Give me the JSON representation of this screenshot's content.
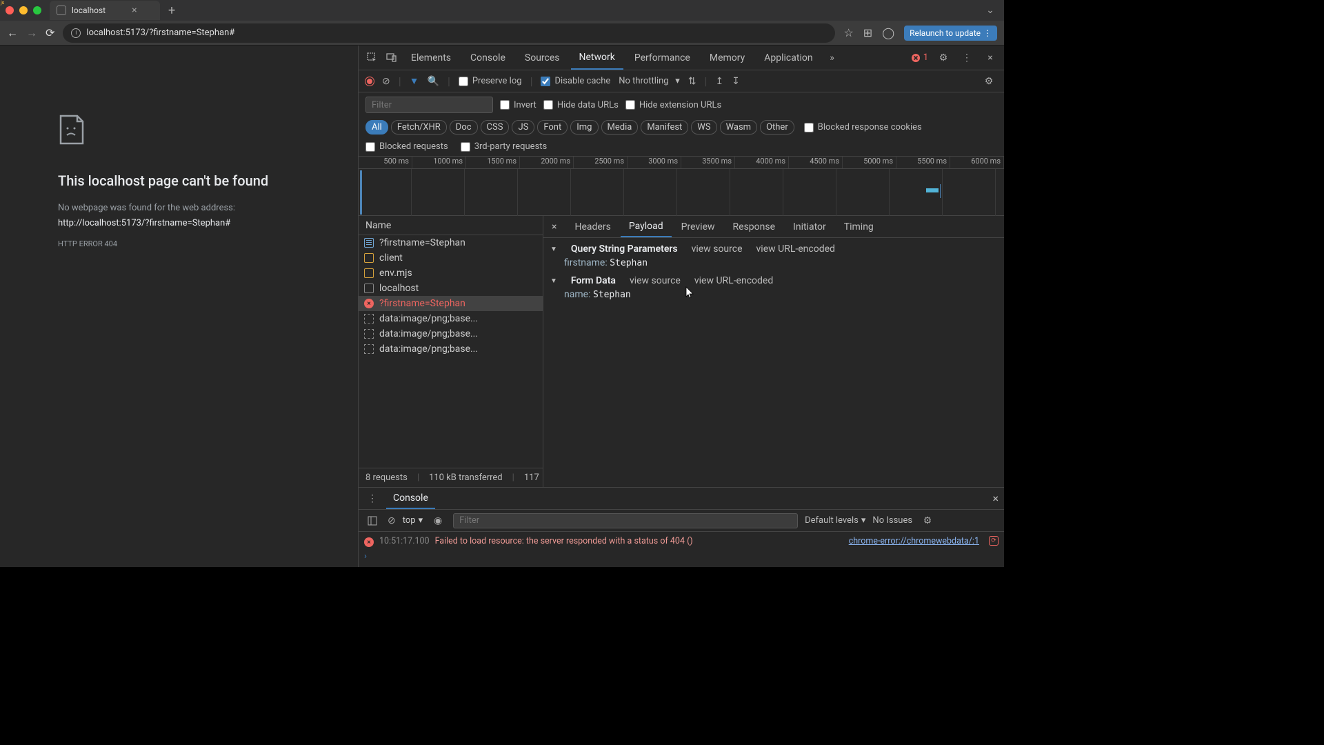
{
  "window": {
    "tab_title": "localhost",
    "url": "localhost:5173/?firstname=Stephan#",
    "relaunch": "Relaunch to update"
  },
  "error_page": {
    "heading": "This localhost page can't be found",
    "subtext": "No webpage was found for the web address:",
    "url": "http://localhost:5173/?firstname=Stephan#",
    "code": "HTTP ERROR 404"
  },
  "devtools": {
    "tabs": {
      "elements": "Elements",
      "console": "Console",
      "sources": "Sources",
      "network": "Network",
      "performance": "Performance",
      "memory": "Memory",
      "application": "Application"
    },
    "errors_count": "1",
    "network": {
      "preserve_log": "Preserve log",
      "disable_cache": "Disable cache",
      "throttling": "No throttling",
      "filter_placeholder": "Filter",
      "invert": "Invert",
      "hide_data": "Hide data URLs",
      "hide_ext": "Hide extension URLs",
      "types": {
        "all": "All",
        "fetch": "Fetch/XHR",
        "doc": "Doc",
        "css": "CSS",
        "js": "JS",
        "font": "Font",
        "img": "Img",
        "media": "Media",
        "manifest": "Manifest",
        "ws": "WS",
        "wasm": "Wasm",
        "other": "Other"
      },
      "blocked_cookies": "Blocked response cookies",
      "blocked_req": "Blocked requests",
      "thirdparty": "3rd-party requests",
      "ticks": [
        "500 ms",
        "1000 ms",
        "1500 ms",
        "2000 ms",
        "2500 ms",
        "3000 ms",
        "3500 ms",
        "4000 ms",
        "4500 ms",
        "5000 ms",
        "5500 ms",
        "6000 ms"
      ],
      "name_hdr": "Name",
      "requests": [
        {
          "name": "?firstname=Stephan",
          "type": "doc"
        },
        {
          "name": "client",
          "type": "js"
        },
        {
          "name": "env.mjs",
          "type": "js"
        },
        {
          "name": "localhost",
          "type": "other"
        },
        {
          "name": "?firstname=Stephan",
          "type": "error"
        },
        {
          "name": "data:image/png;base...",
          "type": "img"
        },
        {
          "name": "data:image/png;base...",
          "type": "img"
        },
        {
          "name": "data:image/png;base...",
          "type": "img"
        }
      ],
      "summary": {
        "requests": "8 requests",
        "transferred": "110 kB transferred",
        "resources": "117"
      },
      "detail_tabs": {
        "headers": "Headers",
        "payload": "Payload",
        "preview": "Preview",
        "response": "Response",
        "initiator": "Initiator",
        "timing": "Timing"
      },
      "payload": {
        "qsp_title": "Query String Parameters",
        "view_source": "view source",
        "view_url": "view URL-encoded",
        "qsp_key": "firstname:",
        "qsp_val": "Stephan",
        "fd_title": "Form Data",
        "fd_key": "name:",
        "fd_val": "Stephan"
      }
    },
    "drawer": {
      "console_tab": "Console",
      "context": "top",
      "filter_placeholder": "Filter",
      "levels": "Default levels",
      "issues": "No Issues",
      "log_time": "10:51:17.100",
      "log_msg": "Failed to load resource: the server responded with a status of 404 ()",
      "log_link": "chrome-error://chromewebdata/:1"
    }
  }
}
